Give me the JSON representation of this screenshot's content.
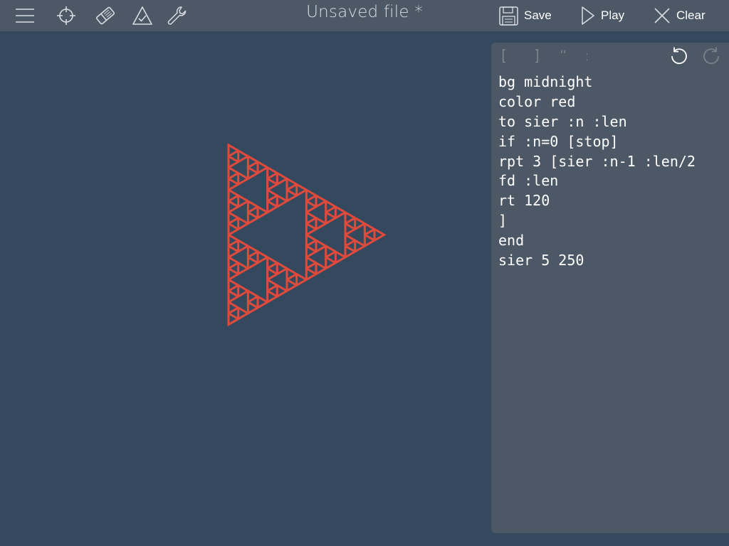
{
  "header": {
    "title": "Unsaved file *",
    "icons": [
      "menu-icon",
      "crosshair-icon",
      "eraser-icon",
      "turtle-triangle-icon",
      "wrench-icon"
    ],
    "actions": {
      "save_label": "Save",
      "play_label": "Play",
      "clear_label": "Clear"
    }
  },
  "editor": {
    "symbols": {
      "open_bracket": "[",
      "close_bracket": "]",
      "quote": "“",
      "colon": ":"
    },
    "history_icons": [
      "undo-icon",
      "redo-icon"
    ],
    "code_lines": [
      "bg midnight",
      "color red",
      "to sier :n :len",
      "if :n=0 [stop]",
      "rpt 3 [sier :n-1 :len/2",
      "fd :len",
      "rt 120",
      "]",
      "end",
      "sier 5 250"
    ]
  },
  "canvas": {
    "background": "#35495e",
    "pen_color": "#e04a3c",
    "drawing": {
      "procedure": "sier",
      "depth": 5,
      "length": 250,
      "turn_degrees": 120
    }
  },
  "colors": {
    "topbar": "#4c5866",
    "editor_panel": "#4c5866",
    "canvas_bg": "#35495e",
    "text": "#ffffff",
    "muted_icon": "#9aa3ad",
    "pen": "#e04a3c"
  }
}
